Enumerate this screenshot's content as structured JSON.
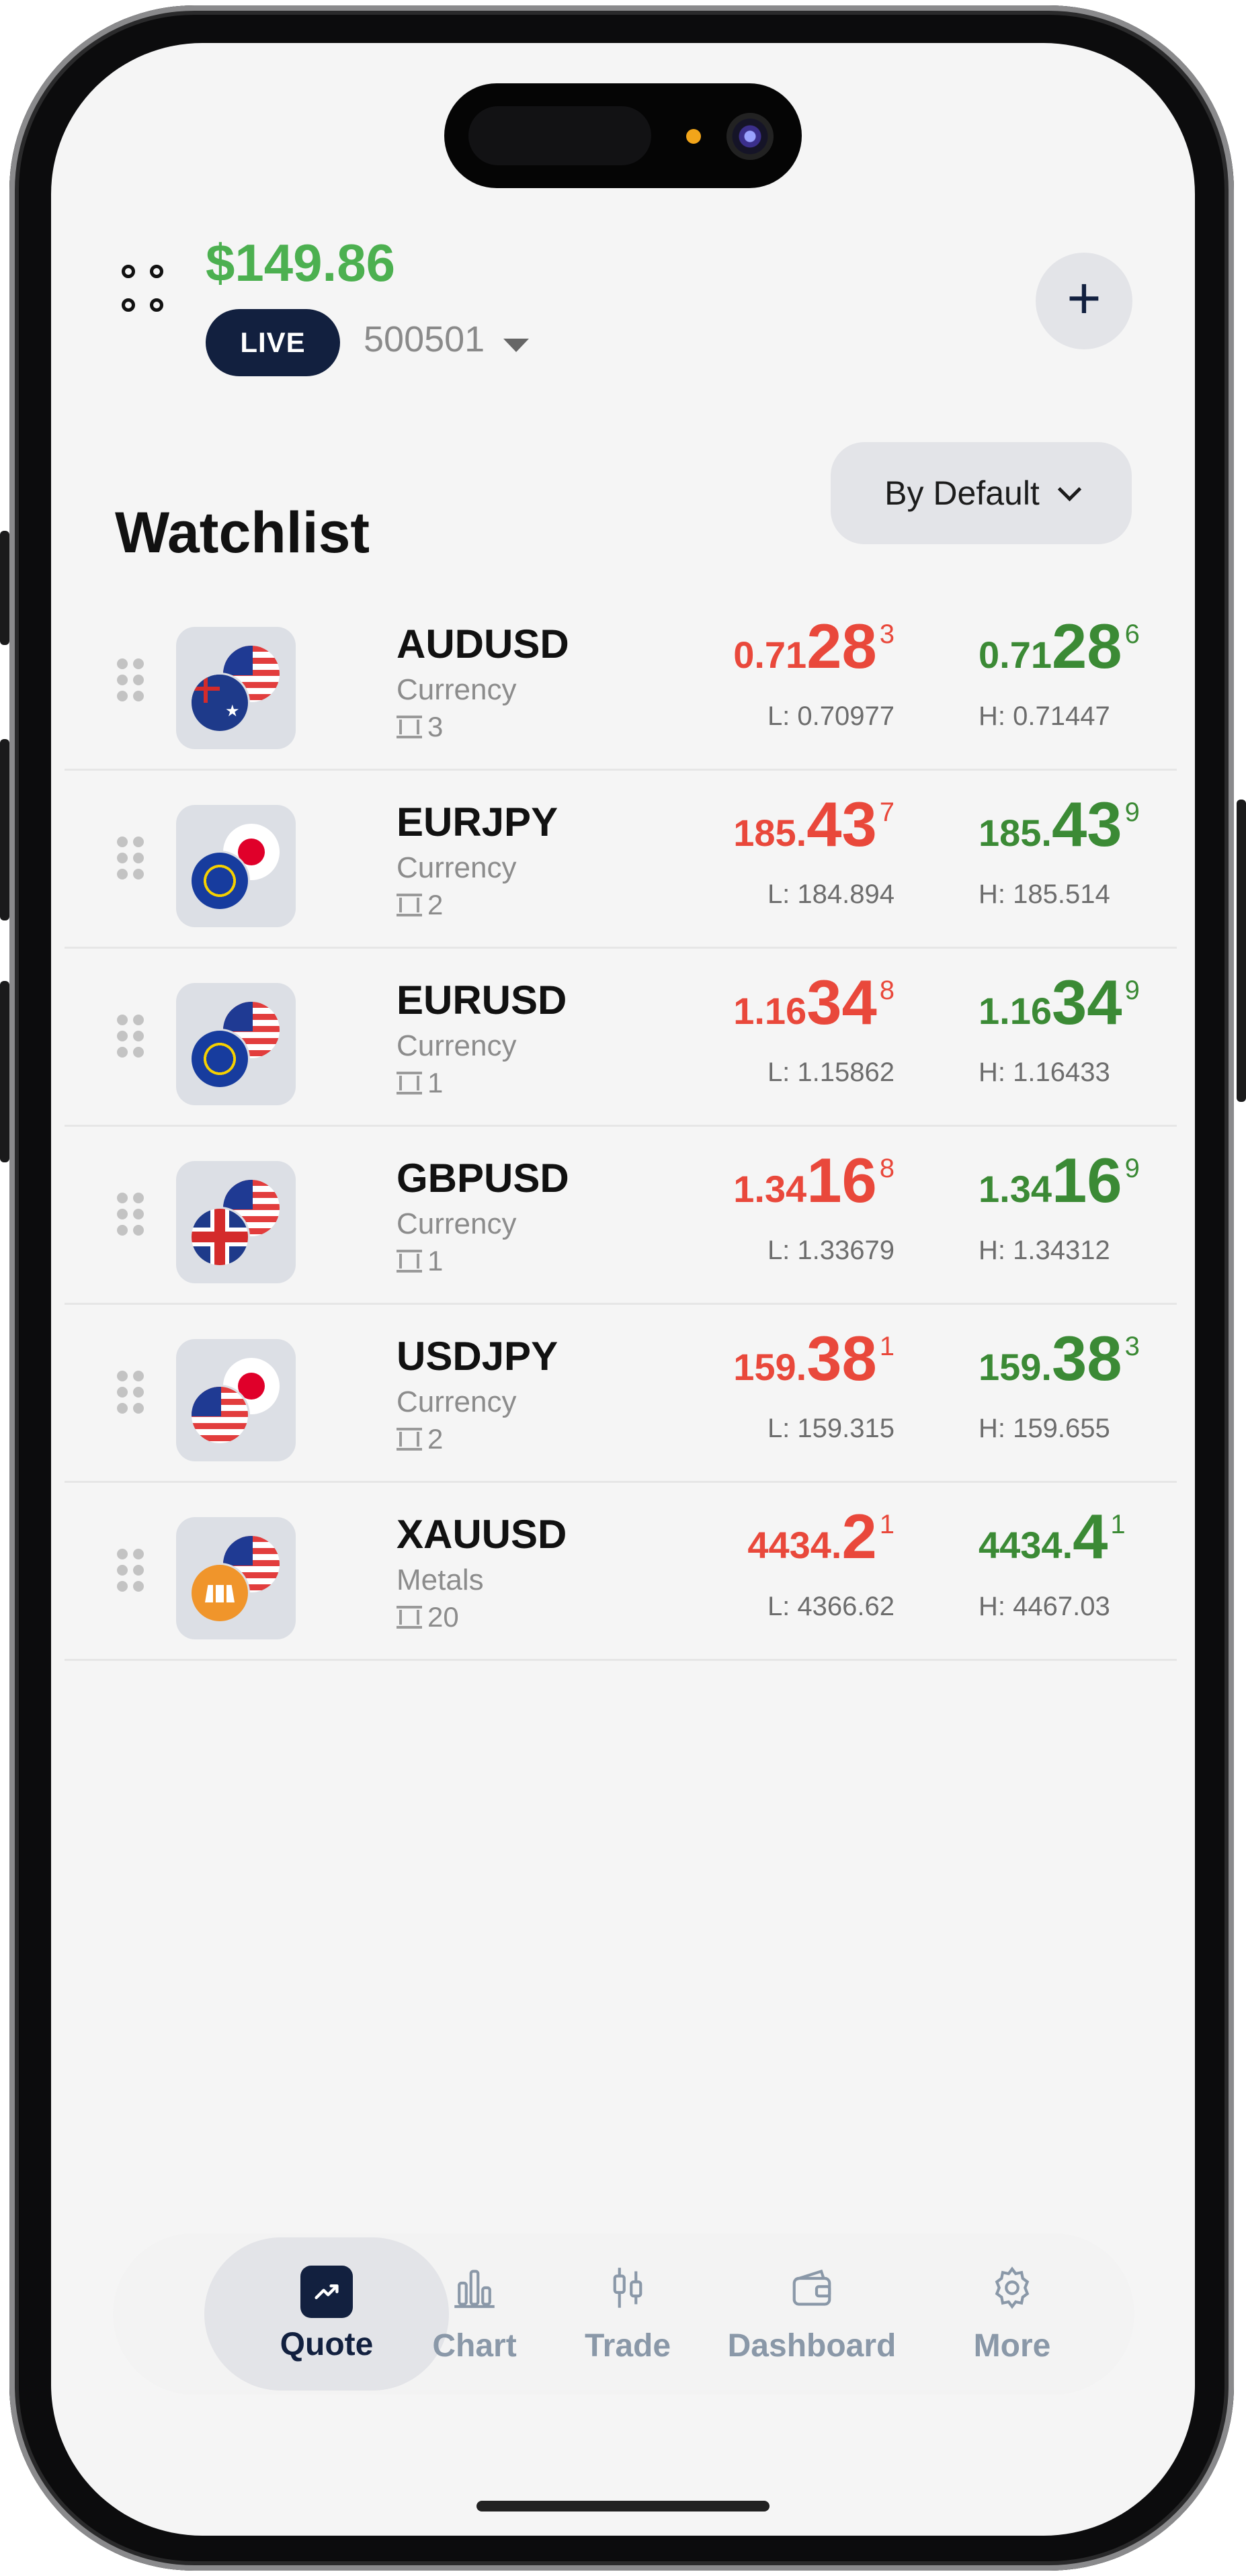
{
  "header": {
    "balance": "$149.86",
    "account_type": "LIVE",
    "account_number": "500501"
  },
  "watchlist": {
    "title": "Watchlist",
    "sort_label": "By Default",
    "rows": [
      {
        "symbol": "AUDUSD",
        "category": "Currency",
        "lot": "3",
        "bid": {
          "prefix": "0.71",
          "big": "28",
          "sup": "3"
        },
        "ask": {
          "prefix": "0.71",
          "big": "28",
          "sup": "6"
        },
        "low": "L: 0.70977",
        "high": "H: 0.71447",
        "flags": [
          "au",
          "us"
        ]
      },
      {
        "symbol": "EURJPY",
        "category": "Currency",
        "lot": "2",
        "bid": {
          "prefix": "185.",
          "big": "43",
          "sup": "7"
        },
        "ask": {
          "prefix": "185.",
          "big": "43",
          "sup": "9"
        },
        "low": "L: 184.894",
        "high": "H: 185.514",
        "flags": [
          "eu",
          "jp"
        ]
      },
      {
        "symbol": "EURUSD",
        "category": "Currency",
        "lot": "1",
        "bid": {
          "prefix": "1.16",
          "big": "34",
          "sup": "8"
        },
        "ask": {
          "prefix": "1.16",
          "big": "34",
          "sup": "9"
        },
        "low": "L: 1.15862",
        "high": "H: 1.16433",
        "flags": [
          "eu",
          "us"
        ]
      },
      {
        "symbol": "GBPUSD",
        "category": "Currency",
        "lot": "1",
        "bid": {
          "prefix": "1.34",
          "big": "16",
          "sup": "8"
        },
        "ask": {
          "prefix": "1.34",
          "big": "16",
          "sup": "9"
        },
        "low": "L: 1.33679",
        "high": "H: 1.34312",
        "flags": [
          "gb",
          "us"
        ]
      },
      {
        "symbol": "USDJPY",
        "category": "Currency",
        "lot": "2",
        "bid": {
          "prefix": "159.",
          "big": "38",
          "sup": "1"
        },
        "ask": {
          "prefix": "159.",
          "big": "38",
          "sup": "3"
        },
        "low": "L: 159.315",
        "high": "H: 159.655",
        "flags": [
          "us",
          "jp"
        ]
      },
      {
        "symbol": "XAUUSD",
        "category": "Metals",
        "lot": "20",
        "bid": {
          "prefix": "4434.",
          "big": "2",
          "sup": "1"
        },
        "ask": {
          "prefix": "4434.",
          "big": "4",
          "sup": "1"
        },
        "low": "L: 4366.62",
        "high": "H: 4467.03",
        "flags": [
          "gold",
          "us"
        ]
      }
    ]
  },
  "nav": {
    "items": [
      {
        "label": "Quote",
        "icon": "trend-up-icon",
        "active": true
      },
      {
        "label": "Chart",
        "icon": "bar-chart-icon",
        "active": false
      },
      {
        "label": "Trade",
        "icon": "candlestick-icon",
        "active": false
      },
      {
        "label": "Dashboard",
        "icon": "wallet-icon",
        "active": false
      },
      {
        "label": "More",
        "icon": "gear-icon",
        "active": false
      }
    ]
  },
  "colors": {
    "bid": "#e9483b",
    "ask": "#3b8a35",
    "balance": "#4cb050",
    "navy": "#12203f"
  }
}
